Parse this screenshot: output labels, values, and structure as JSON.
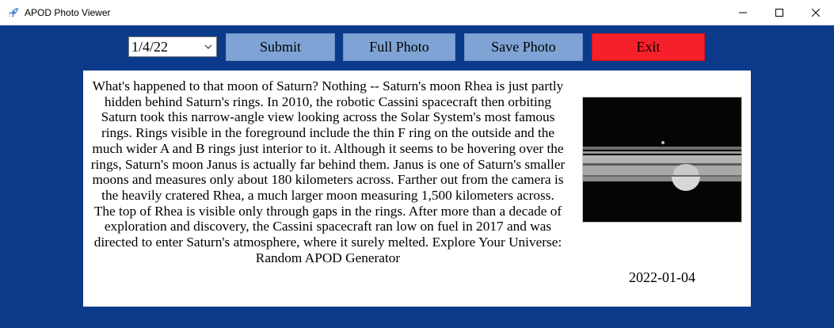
{
  "window": {
    "title": "APOD Photo Viewer",
    "icon": "rocket-icon",
    "controls": [
      "minimize-icon",
      "maximize-icon",
      "close-icon"
    ]
  },
  "toolbar": {
    "date_value": "1/4/22",
    "submit_label": "Submit",
    "full_photo_label": "Full Photo",
    "save_photo_label": "Save Photo",
    "exit_label": "Exit",
    "accent_button_color": "#7fa3d4",
    "exit_button_color": "#f5202a"
  },
  "content": {
    "description": "What's happened to that moon of Saturn? Nothing -- Saturn's moon Rhea is just partly hidden behind Saturn's rings. In 2010, the robotic Cassini spacecraft then orbiting Saturn took this narrow-angle view looking across the Solar System's most famous rings. Rings visible in the foreground include the thin F ring on the outside and the much wider A and B rings just interior to it. Although it seems to be hovering over the rings, Saturn's moon Janus is actually far behind them.  Janus is one of Saturn's smaller moons and measures only about 180 kilometers across. Farther out from the camera is the heavily cratered Rhea, a much larger moon measuring 1,500 kilometers across. The top of Rhea is visible only through gaps in the rings. After more than a decade of exploration and discovery, the Cassini spacecraft ran low on fuel in 2017 and was directed to enter Saturn's atmosphere, where it surely melted.   Explore Your Universe: Random APOD Generator",
    "photo_date": "2022-01-04"
  },
  "colors": {
    "window_background": "#0c3a8a",
    "panel_background": "#ffffff"
  }
}
